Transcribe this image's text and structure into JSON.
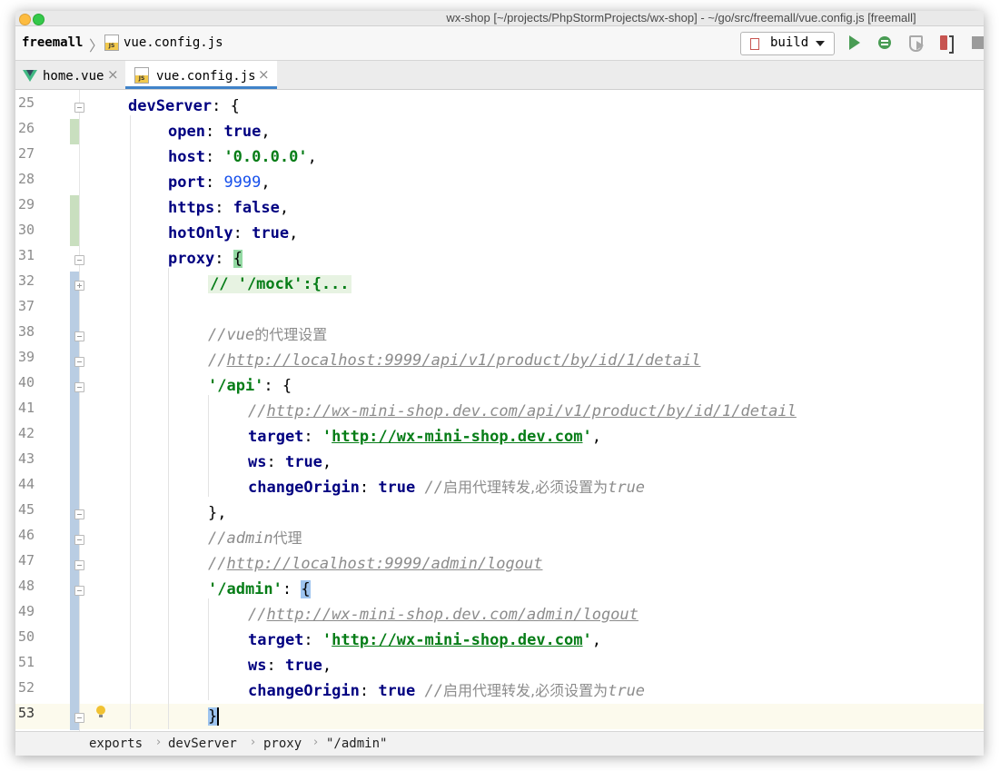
{
  "window": {
    "title": "wx-shop [~/projects/PhpStormProjects/wx-shop] - ~/go/src/freemall/vue.config.js [freemall]"
  },
  "navbar": {
    "project": "freemall",
    "separator": "〉",
    "file": "vue.config.js",
    "run_config": "build",
    "icons": [
      "run-icon",
      "debug-icon",
      "coverage-icon",
      "profile-icon",
      "stop-icon"
    ]
  },
  "tabs": [
    {
      "label": "home.vue",
      "close": "×",
      "icon": "vue-icon",
      "active": false
    },
    {
      "label": "vue.config.js",
      "close": "×",
      "icon": "js-file-icon",
      "active": true
    }
  ],
  "editor": {
    "caret_line": 53,
    "lines": [
      {
        "num": "25"
      },
      {
        "num": "26"
      },
      {
        "num": "27"
      },
      {
        "num": "28"
      },
      {
        "num": "29"
      },
      {
        "num": "30"
      },
      {
        "num": "31"
      },
      {
        "num": "32"
      },
      {
        "num": "37"
      },
      {
        "num": "38"
      },
      {
        "num": "39"
      },
      {
        "num": "40"
      },
      {
        "num": "41"
      },
      {
        "num": "42"
      },
      {
        "num": "43"
      },
      {
        "num": "44"
      },
      {
        "num": "45"
      },
      {
        "num": "46"
      },
      {
        "num": "47"
      },
      {
        "num": "48"
      },
      {
        "num": "49"
      },
      {
        "num": "50"
      },
      {
        "num": "51"
      },
      {
        "num": "52"
      },
      {
        "num": "53"
      }
    ],
    "tokens": {
      "l25": {
        "key": "devServer",
        "rest": ": {"
      },
      "l26": {
        "key": "open",
        "colon": ": ",
        "val": "true",
        "end": ","
      },
      "l27": {
        "key": "host",
        "colon": ": ",
        "val": "'0.0.0.0'",
        "end": ","
      },
      "l28": {
        "key": "port",
        "colon": ": ",
        "val": "9999",
        "end": ","
      },
      "l29": {
        "key": "https",
        "colon": ": ",
        "val": "false",
        "end": ","
      },
      "l30": {
        "key": "hotOnly",
        "colon": ": ",
        "val": "true",
        "end": ","
      },
      "l31": {
        "key": "proxy",
        "colon": ": ",
        "brace": "{"
      },
      "l32": {
        "folded": "// '/mock':{..."
      },
      "l38": {
        "prefix": "//",
        "mid": "vue",
        "cn": "的代理设置"
      },
      "l39": {
        "prefix": "//",
        "url": "http://localhost:9999/api/v1/product/by/id/1/detail"
      },
      "l40": {
        "key": "'/api'",
        "rest": ": {"
      },
      "l41": {
        "prefix": "//",
        "url": "http://wx-mini-shop.dev.com/api/v1/product/by/id/1/detail"
      },
      "l42": {
        "key": "target",
        "colon": ": ",
        "q1": "'",
        "url": "http://wx-mini-shop.dev.com",
        "q2": "'",
        "end": ","
      },
      "l43": {
        "key": "ws",
        "colon": ": ",
        "val": "true",
        "end": ","
      },
      "l44": {
        "key": "changeOrigin",
        "colon": ": ",
        "val": "true",
        "space": " ",
        "comment": "//",
        "cn": "启用代理转发,必须设置为",
        "tail": "true"
      },
      "l45": {
        "text": "},"
      },
      "l46": {
        "prefix": "//",
        "mid": "admin",
        "cn": "代理"
      },
      "l47": {
        "prefix": "//",
        "url": "http://localhost:9999/admin/logout"
      },
      "l48": {
        "key": "'/admin'",
        "colon": ": ",
        "brace": "{"
      },
      "l49": {
        "prefix": "//",
        "url": "http://wx-mini-shop.dev.com/admin/logout"
      },
      "l50": {
        "key": "target",
        "colon": ": ",
        "q1": "'",
        "url": "http://wx-mini-shop.dev.com",
        "q2": "'",
        "end": ","
      },
      "l51": {
        "key": "ws",
        "colon": ": ",
        "val": "true",
        "end": ","
      },
      "l52": {
        "key": "changeOrigin",
        "colon": ": ",
        "val": "true",
        "space": " ",
        "comment": "//",
        "cn": "启用代理转发,必须设置为",
        "tail": "true"
      },
      "l53": {
        "brace": "}"
      }
    }
  },
  "statusbar": {
    "crumbs": [
      "exports",
      "devServer",
      "proxy",
      "\"/admin\""
    ],
    "separator": "›"
  },
  "colors": {
    "keyword": "#000080",
    "string": "#067d17",
    "number": "#1750eb",
    "comment": "#8c8c8c",
    "accent": "#4083c9"
  }
}
